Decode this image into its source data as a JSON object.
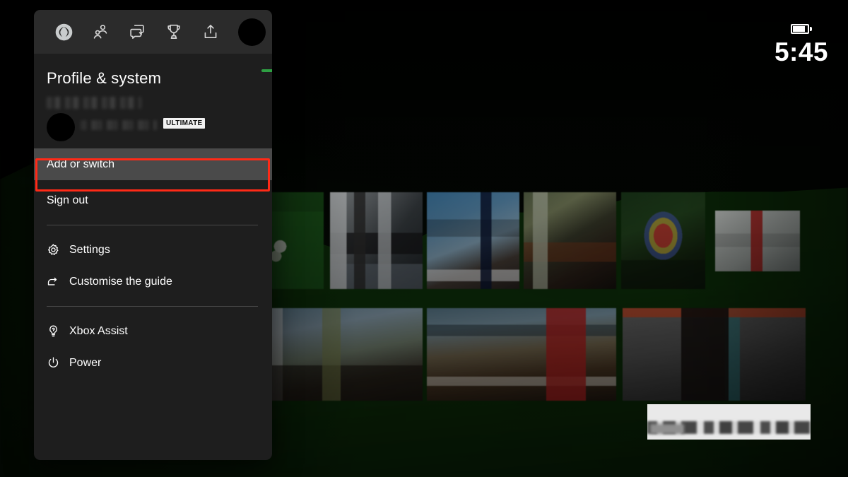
{
  "status": {
    "clock": "5:45",
    "battery_icon": "battery-icon"
  },
  "guide": {
    "tabs": [
      {
        "name": "xbox-home",
        "icon": "xbox-logo-icon"
      },
      {
        "name": "people",
        "icon": "people-icon"
      },
      {
        "name": "messages",
        "icon": "chat-bubble-icon"
      },
      {
        "name": "achievements",
        "icon": "trophy-icon"
      },
      {
        "name": "capture-share",
        "icon": "share-upload-icon"
      },
      {
        "name": "profile-system",
        "icon": "avatar-icon"
      }
    ],
    "title": "Profile & system",
    "account": {
      "gamertag": "",
      "subscription_label": "",
      "badge": "ULTIMATE"
    },
    "menu": [
      {
        "label": "Add or switch",
        "icon": "none",
        "selected": true
      },
      {
        "label": "Sign out",
        "icon": "none",
        "selected": false
      },
      {
        "label": "Settings",
        "icon": "gear-icon",
        "selected": false
      },
      {
        "label": "Customise the guide",
        "icon": "customise-icon",
        "selected": false
      },
      {
        "label": "Xbox Assist",
        "icon": "lightbulb-icon",
        "selected": false
      },
      {
        "label": "Power",
        "icon": "power-icon",
        "selected": false
      }
    ]
  },
  "annotation": {
    "target": "Add or switch",
    "color": "#ff2a17"
  },
  "colors": {
    "panel_bg": "#1e1e1e",
    "tabbar_bg": "#2b2b2b",
    "selected_row": "#4a4a4a",
    "accent_green": "#2ea043",
    "text": "#ffffff",
    "divider": "#4a4a4a"
  }
}
